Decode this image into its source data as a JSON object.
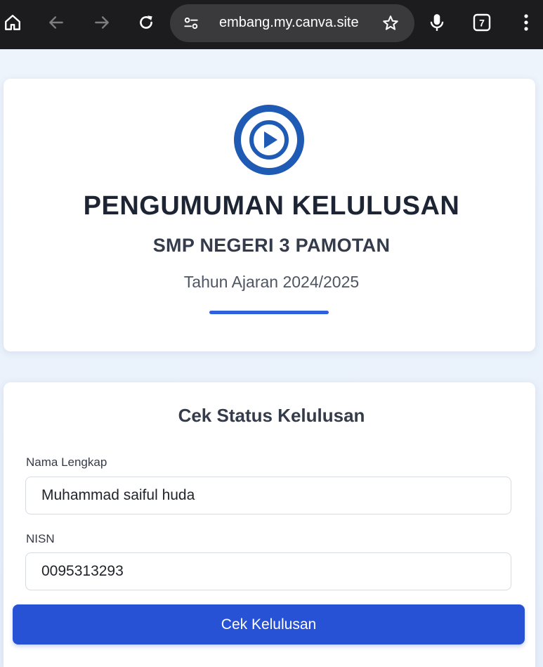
{
  "browser": {
    "url": "embang.my.canva.site",
    "tab_count": "7",
    "icons": [
      "home-icon",
      "back-icon",
      "forward-icon",
      "reload-icon",
      "site-settings-icon",
      "star-icon",
      "mic-icon",
      "tabs-icon",
      "more-icon"
    ]
  },
  "header": {
    "title": "PENGUMUMAN KELULUSAN",
    "school": "SMP NEGERI 3 PAMOTAN",
    "year": "Tahun Ajaran 2024/2025",
    "logo_icon": "play-circle-icon",
    "accent_color": "#2f61dd",
    "logo_color": "#1f5bb5"
  },
  "form": {
    "title": "Cek Status Kelulusan",
    "name_label": "Nama Lengkap",
    "name_value": "Muhammad saiful huda",
    "nisn_label": "NISN",
    "nisn_value": "0095313293",
    "submit_label": "Cek Kelulusan",
    "button_color": "#2852d6"
  }
}
